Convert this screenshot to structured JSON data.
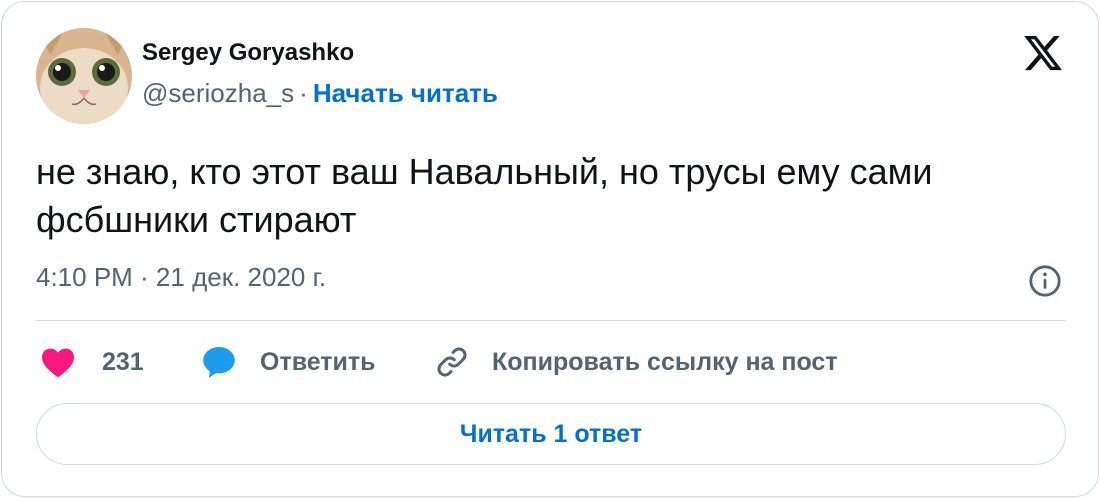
{
  "author": {
    "name": "Sergey Goryashko",
    "handle": "@seriozha_s",
    "separator": "·",
    "follow_label": "Начать читать"
  },
  "tweet": {
    "text": "не знаю, кто этот ваш Навальный, но трусы ему сами фсбшники стирают",
    "timestamp": "4:10 PM · 21 дек. 2020 г."
  },
  "actions": {
    "like_count": "231",
    "reply_label": "Ответить",
    "copy_label": "Копировать ссылку на пост"
  },
  "read_replies_label": "Читать 1 ответ",
  "icons": {
    "logo": "x-logo-icon",
    "info": "info-icon",
    "like": "heart-icon",
    "reply": "speech-bubble-icon",
    "copy": "link-icon"
  },
  "colors": {
    "like": "#f91880",
    "reply": "#1d9bf0",
    "link": "#006fd6",
    "muted": "#536471",
    "border": "#cfd9de"
  }
}
